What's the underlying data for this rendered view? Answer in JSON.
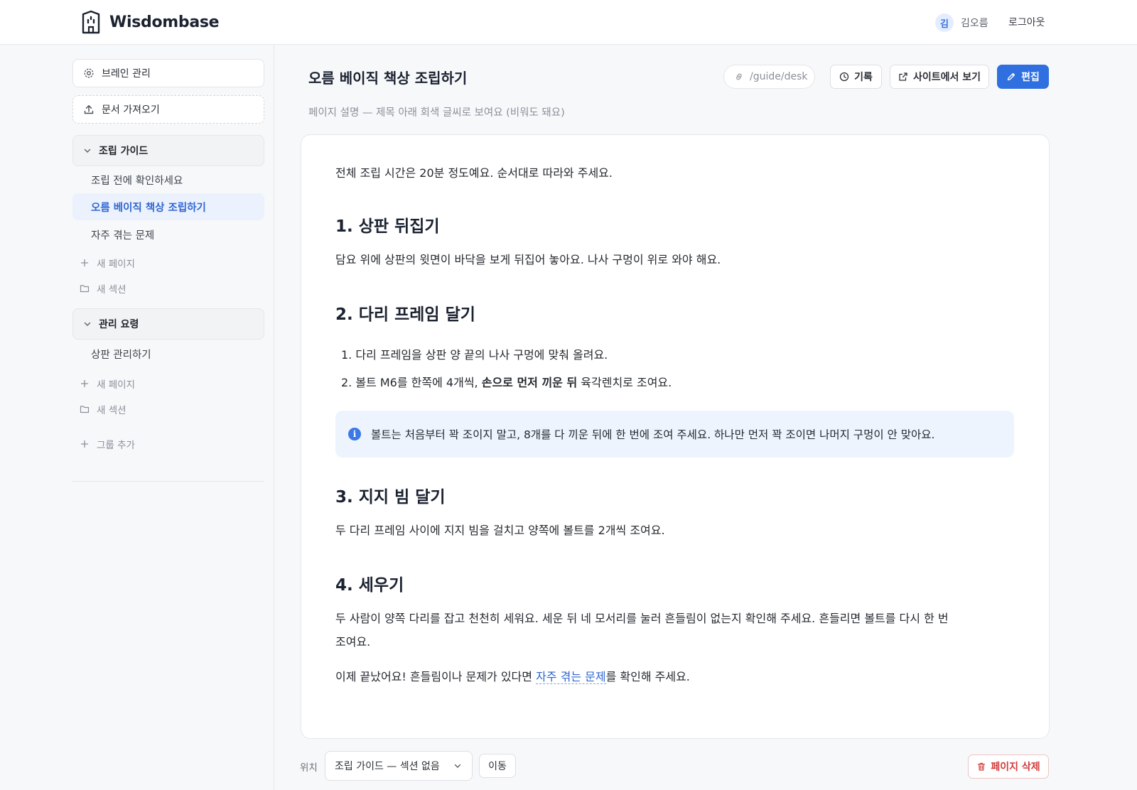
{
  "header": {
    "brand": "Wisdombase",
    "avatar_initial": "김",
    "username": "김오름",
    "logout": "로그아웃"
  },
  "sidebar": {
    "brain_manage": "브레인 관리",
    "import_docs": "문서 가져오기",
    "groups": [
      {
        "title": "조립 가이드",
        "pages": [
          "조립 전에 확인하세요",
          "오름 베이직 책상 조립하기",
          "자주 겪는 문제"
        ],
        "new_page": "새 페이지",
        "new_section": "새 섹션"
      },
      {
        "title": "관리 요령",
        "pages": [
          "상판 관리하기"
        ],
        "new_page": "새 페이지",
        "new_section": "새 섹션"
      }
    ],
    "add_group": "그룹 추가",
    "active_page": "오름 베이직 책상 조립하기"
  },
  "page": {
    "title": "오름 베이직 책상 조립하기",
    "description_placeholder": "페이지 설명 — 제목 아래 회색 글씨로 보여요 (비워도 돼요)",
    "slug": "/guide/desk",
    "history": "기록",
    "view_site": "사이트에서 보기",
    "edit": "편집"
  },
  "content": {
    "intro": "전체 조립 시간은 20분 정도예요. 순서대로 따라와 주세요.",
    "h1": "1. 상판 뒤집기",
    "p1": "담요 위에 상판의 윗면이 바닥을 보게 뒤집어 놓아요. 나사 구멍이 위로 와야 해요.",
    "h2": "2. 다리 프레임 달기",
    "li1": "1. 다리 프레임을 상판 양 끝의 나사 구멍에 맞춰 올려요.",
    "li2_pre": "2. 볼트 M6를 한쪽에 4개씩, ",
    "li2_bold": "손으로 먼저 끼운 뒤",
    "li2_post": " 육각렌치로 조여요.",
    "callout_icon": "i",
    "callout": "볼트는 처음부터 꽉 조이지 말고, 8개를 다 끼운 뒤에 한 번에 조여 주세요. 하나만 먼저 꽉 조이면 나머지 구멍이 안 맞아요.",
    "h3": "3. 지지 빔 달기",
    "p3": "두 다리 프레임 사이에 지지 빔을 걸치고 양쪽에 볼트를 2개씩 조여요.",
    "h4": "4. 세우기",
    "p4_line1": "두 사람이 양쪽 다리를 잡고 천천히 세워요. 세운 뒤 네 모서리를 눌러 흔들림이 없는지 확인해 주세요. 흔들리면 볼트를 다시 한 번",
    "p4_line2": "조여요.",
    "final_pre": "이제 끝났어요! 흔들림이나 문제가 있다면 ",
    "final_link": "자주 겪는 문제",
    "final_post": "를 확인해 주세요."
  },
  "footer": {
    "location_label": "위치",
    "location_value": "조립 가이드 — 섹션 없음",
    "move": "이동",
    "delete": "페이지 삭제"
  },
  "colors": {
    "accent": "#2f6fe0",
    "active_bg": "#ebf1fd",
    "danger": "#d23b3b",
    "callout_bg": "#eef4fd"
  }
}
